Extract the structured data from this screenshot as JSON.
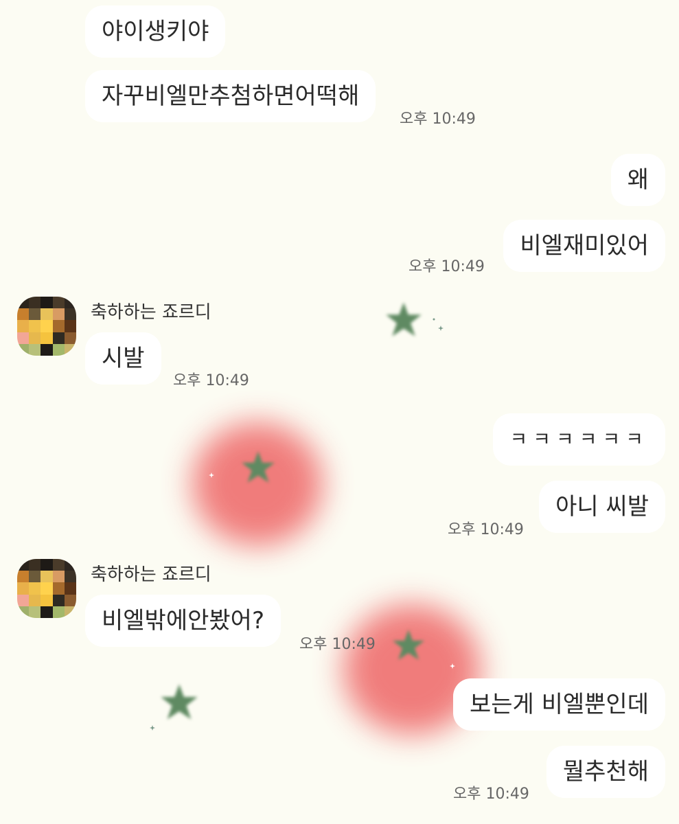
{
  "messages": [
    {
      "text": "야이생키야"
    },
    {
      "text": "자꾸비엘만추첨하면어떡해",
      "time": "오후 10:49"
    },
    {
      "text": "왜"
    },
    {
      "text": "비엘재미있어",
      "time": "오후 10:49"
    },
    {
      "text": "시발",
      "time": "오후 10:49"
    },
    {
      "text": "ㅋㅋㅋㅋㅋㅋ"
    },
    {
      "text": "아니 씨발",
      "time": "오후 10:49"
    },
    {
      "text": "비엘밖에안봤어?",
      "time": "오후 10:49"
    },
    {
      "text": "보는게 비엘뿐인데"
    },
    {
      "text": "뭘추천해",
      "time": "오후 10:49"
    }
  ],
  "senders": [
    {
      "name": "축하하는 죠르디"
    },
    {
      "name": "축하하는 죠르디"
    }
  ],
  "colors": {
    "background": "#fcfcf3",
    "bubble": "#ffffff",
    "blob": "#ef6f6f",
    "star": "#5f8a62"
  },
  "icons": [
    "avatar-pixelated",
    "star-icon",
    "sparkle-icon"
  ]
}
